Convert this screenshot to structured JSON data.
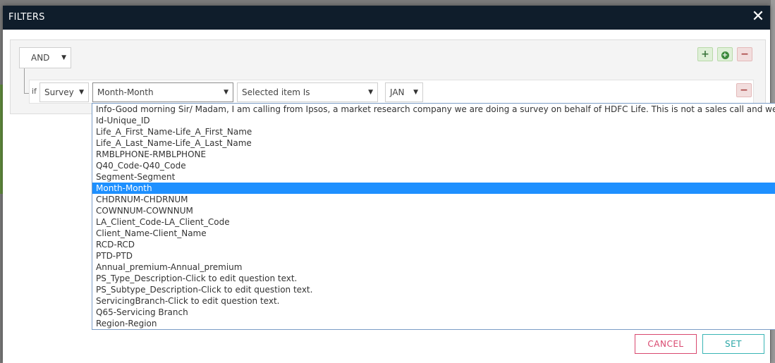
{
  "dialog": {
    "title": "FILTERS",
    "close_glyph": "✕"
  },
  "group": {
    "condition": "AND",
    "add_rule_glyph": "+",
    "add_group_glyph": "+",
    "remove_group_glyph": "−"
  },
  "rule": {
    "if_label": "if",
    "survey": "Survey",
    "field": "Month-Month",
    "operator": "Selected item Is",
    "value": "JAN",
    "remove_glyph": "−"
  },
  "field_options": [
    "Info-Good morning Sir/ Madam, I am calling from Ipsos, a market research company we are doing a survey on behalf of HDFC Life. This is not a sales call and we are interested",
    "Id-Unique_ID",
    "Life_A_First_Name-Life_A_First_Name",
    "Life_A_Last_Name-Life_A_Last_Name",
    "RMBLPHONE-RMBLPHONE",
    "Q40_Code-Q40_Code",
    "Segment-Segment",
    "Month-Month",
    "CHDRNUM-CHDRNUM",
    "COWNNUM-COWNNUM",
    "LA_Client_Code-LA_Client_Code",
    "Client_Name-Client_Name",
    "RCD-RCD",
    "PTD-PTD",
    "Annual_premium-Annual_premium",
    "PS_Type_Description-Click to edit question text.",
    "PS_Subtype_Description-Click to edit question text.",
    "ServicingBranch-Click to edit question text.",
    "Q65-Servicing Branch",
    "Region-Region"
  ],
  "selected_option_index": 7,
  "footer": {
    "cancel_label": "CANCEL",
    "set_label": "SET"
  },
  "colors": {
    "header_bg": "#0f1d2b",
    "selected_option_bg": "#1e90ff",
    "cancel": "#d9486f",
    "set": "#39b5b5"
  }
}
